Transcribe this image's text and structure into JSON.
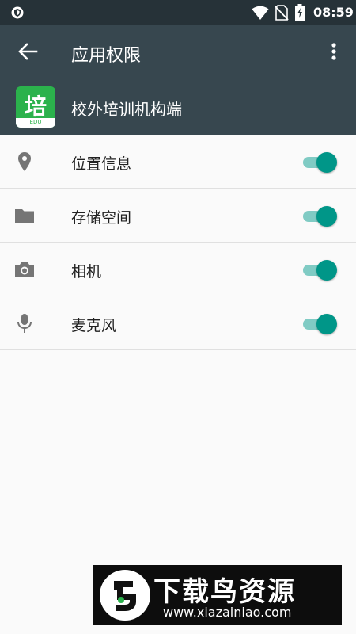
{
  "status_bar": {
    "time": "08:59",
    "icons": [
      "shield-icon",
      "wifi-icon",
      "no-sim-icon",
      "battery-charging-icon"
    ]
  },
  "toolbar": {
    "title": "应用权限",
    "back_icon": "arrow-back-icon",
    "more_icon": "more-vert-icon"
  },
  "app": {
    "name": "校外培训机构端",
    "icon_glyph": "培",
    "icon_caption": "EDU"
  },
  "permissions": [
    {
      "label": "位置信息",
      "icon": "location-icon",
      "enabled": true
    },
    {
      "label": "存储空间",
      "icon": "folder-icon",
      "enabled": true
    },
    {
      "label": "相机",
      "icon": "camera-icon",
      "enabled": true
    },
    {
      "label": "麦克风",
      "icon": "microphone-icon",
      "enabled": true
    }
  ],
  "watermark": {
    "title": "下载鸟资源",
    "url": "www.xiazainiao.com"
  },
  "colors": {
    "status_bar": "#263238",
    "toolbar": "#37474f",
    "toggle_on_thumb": "#009688",
    "toggle_on_track": "#80cbc4",
    "app_icon": "#2bb24c"
  }
}
